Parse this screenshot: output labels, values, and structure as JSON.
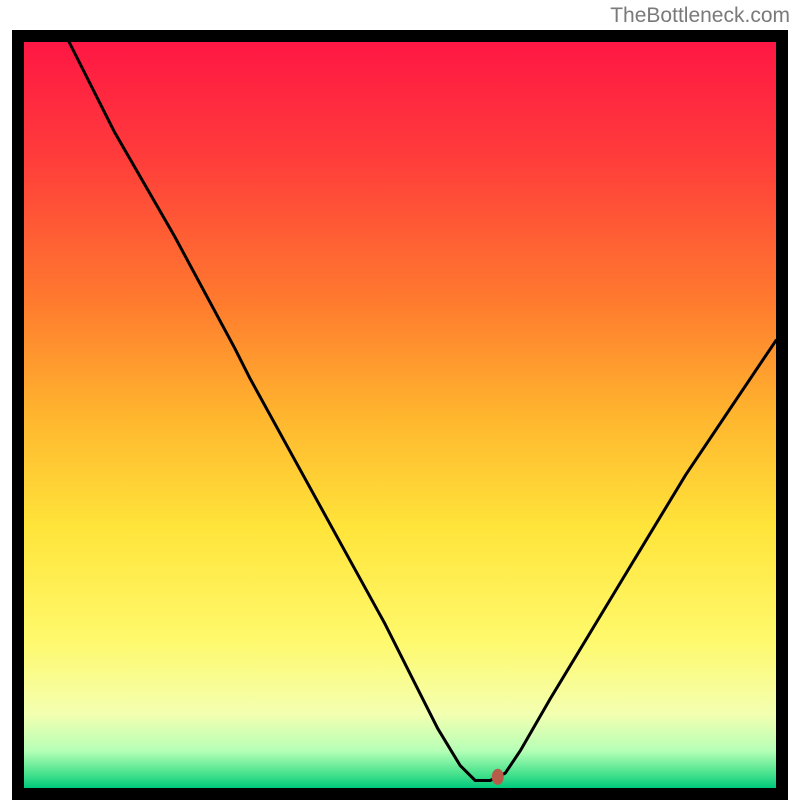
{
  "watermark": "TheBottleneck.com",
  "chart_data": {
    "type": "line",
    "title": "",
    "xlabel": "",
    "ylabel": "",
    "xlim": [
      0,
      100
    ],
    "ylim": [
      0,
      100
    ],
    "gradient_stops": [
      {
        "offset": 0,
        "color": "#ff1744"
      },
      {
        "offset": 15,
        "color": "#ff3b3b"
      },
      {
        "offset": 35,
        "color": "#ff7b2e"
      },
      {
        "offset": 50,
        "color": "#ffb52e"
      },
      {
        "offset": 65,
        "color": "#ffe43a"
      },
      {
        "offset": 80,
        "color": "#fff96b"
      },
      {
        "offset": 90,
        "color": "#f4ffb0"
      },
      {
        "offset": 95,
        "color": "#b6ffb6"
      },
      {
        "offset": 98,
        "color": "#4be38e"
      },
      {
        "offset": 100,
        "color": "#00c97b"
      }
    ],
    "series": [
      {
        "name": "bottleneck-curve",
        "color": "#000000",
        "x": [
          6,
          12,
          20,
          28,
          30,
          36,
          42,
          48,
          52,
          55,
          58,
          60,
          62,
          64,
          66,
          70,
          76,
          82,
          88,
          94,
          100
        ],
        "y": [
          100,
          88,
          74,
          59,
          55,
          44,
          33,
          22,
          14,
          8,
          3,
          1,
          1,
          2,
          5,
          12,
          22,
          32,
          42,
          51,
          60
        ]
      }
    ],
    "marker": {
      "name": "optimal-point",
      "x": 63,
      "y": 1.5,
      "color": "#b85c4a",
      "rx": 6,
      "ry": 8
    }
  }
}
